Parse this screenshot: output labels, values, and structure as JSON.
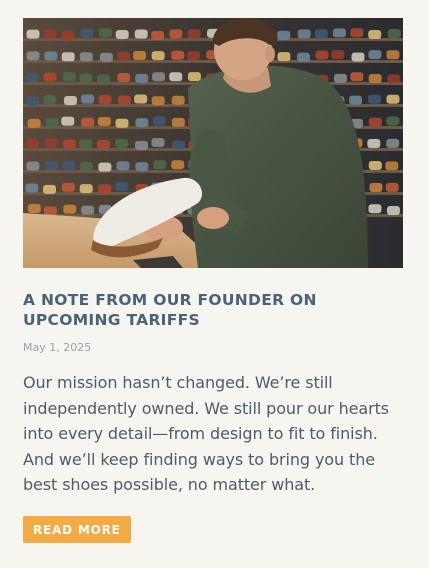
{
  "post": {
    "image": {
      "icon": "shoe-store-photo",
      "alt": ""
    },
    "title": "A NOTE FROM OUR FOUNDER ON UPCOMING TARIFFS",
    "date": "May 1, 2025",
    "excerpt": "Our mission hasn’t changed. We’re still independently owned. We still pour our hearts into every detail—from design to fit to finish. And we’ll keep finding ways to bring you the best shoes possible, no matter what.",
    "read_more_label": "READ MORE"
  },
  "colors": {
    "background": "#f7f5ef",
    "title": "#4a6378",
    "date": "#93a3b3",
    "body": "#4b5d6c",
    "button": "#f5ab45",
    "button_text": "#ffffff"
  }
}
